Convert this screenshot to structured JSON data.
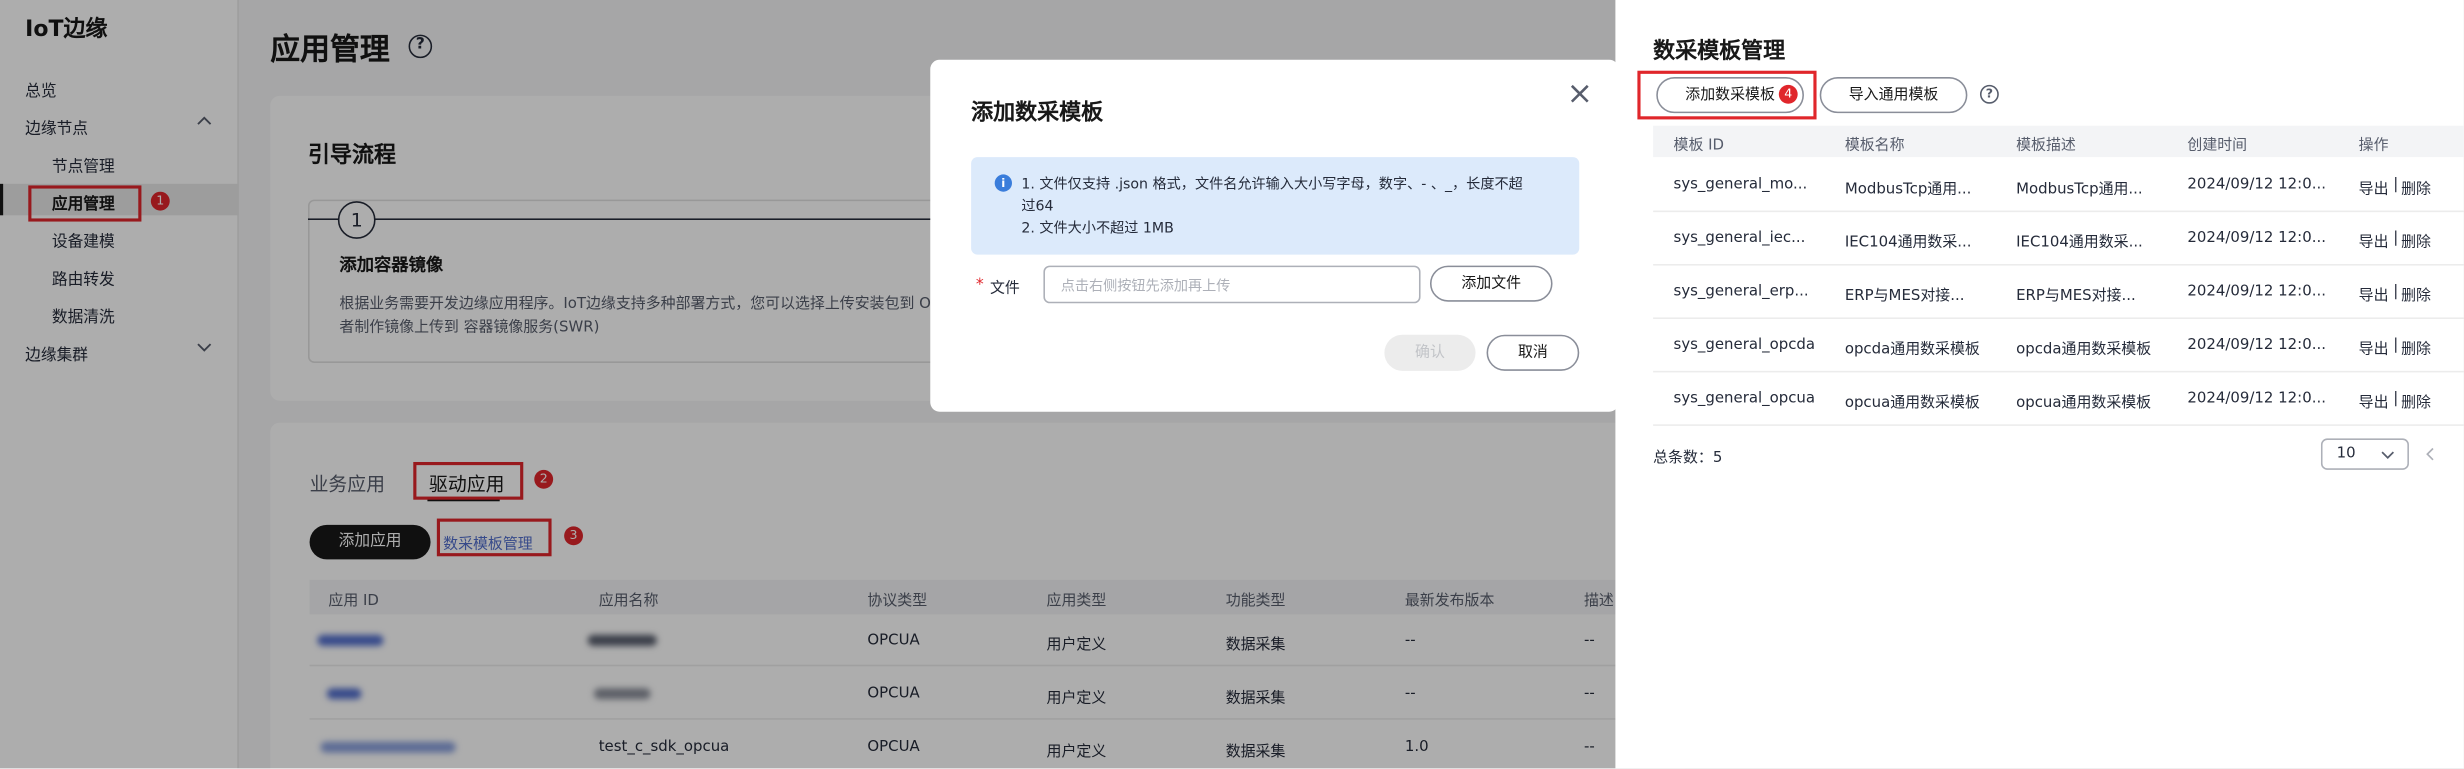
{
  "sidebar": {
    "brand": "IoT边缘",
    "items": [
      {
        "label": "总览"
      },
      {
        "label": "边缘节点"
      },
      {
        "label": "节点管理"
      },
      {
        "label": "应用管理"
      },
      {
        "label": "设备建模"
      },
      {
        "label": "路由转发"
      },
      {
        "label": "数据清洗"
      },
      {
        "label": "边缘集群"
      }
    ]
  },
  "page": {
    "title": "应用管理",
    "help": "?"
  },
  "guide": {
    "title": "引导流程",
    "step_number": "1",
    "step_title": "添加容器镜像",
    "step_desc_1": "根据业务需要开发边缘应用程序。IoT边缘支持多种部署方式，您可以选择上传安装包到 O",
    "step_desc_2": "者制作镜像上传到 容器镜像服务(SWR)"
  },
  "tabs": [
    {
      "label": "业务应用"
    },
    {
      "label": "驱动应用"
    }
  ],
  "actions": {
    "add_app": "添加应用",
    "template_mgmt": "数采模板管理"
  },
  "badges": {
    "b1": "1",
    "b2": "2",
    "b3": "3",
    "b4": "4"
  },
  "app_table": {
    "headers": [
      "应用 ID",
      "应用名称",
      "协议类型",
      "应用类型",
      "功能类型",
      "最新发布版本",
      "描述"
    ],
    "rows": [
      {
        "name": "",
        "protocol": "OPCUA",
        "app_type": "用户定义",
        "func_type": "数据采集",
        "version": "--",
        "desc": "--"
      },
      {
        "name": "",
        "protocol": "OPCUA",
        "app_type": "用户定义",
        "func_type": "数据采集",
        "version": "--",
        "desc": "--"
      },
      {
        "name": "test_c_sdk_opcua",
        "protocol": "OPCUA",
        "app_type": "用户定义",
        "func_type": "数据采集",
        "version": "1.0",
        "desc": "--"
      }
    ]
  },
  "drawer": {
    "title": "数采模板管理",
    "add_btn": "添加数采模板",
    "import_btn": "导入通用模板",
    "help": "?",
    "headers": [
      "模板 ID",
      "模板名称",
      "模板描述",
      "创建时间",
      "操作"
    ],
    "rows": [
      {
        "id": "sys_general_mo...",
        "name": "ModbusTcp通用...",
        "desc": "ModbusTcp通用...",
        "time": "2024/09/12 12:0...",
        "export": "导出",
        "sep": "|",
        "delete": "删除"
      },
      {
        "id": "sys_general_iec...",
        "name": "IEC104通用数采...",
        "desc": "IEC104通用数采...",
        "time": "2024/09/12 12:0...",
        "export": "导出",
        "sep": "|",
        "delete": "删除"
      },
      {
        "id": "sys_general_erp...",
        "name": "ERP与MES对接...",
        "desc": "ERP与MES对接...",
        "time": "2024/09/12 12:0...",
        "export": "导出",
        "sep": "|",
        "delete": "删除"
      },
      {
        "id": "sys_general_opcda",
        "name": "opcda通用数采模板",
        "desc": "opcda通用数采模板",
        "time": "2024/09/12 12:0...",
        "export": "导出",
        "sep": "|",
        "delete": "删除"
      },
      {
        "id": "sys_general_opcua",
        "name": "opcua通用数采模板",
        "desc": "opcua通用数采模板",
        "time": "2024/09/12 12:0...",
        "export": "导出",
        "sep": "|",
        "delete": "删除"
      }
    ],
    "total_label": "总条数：5",
    "page_size": "10"
  },
  "dialog": {
    "title": "添加数采模板",
    "close": "×",
    "info_1": "1. 文件仅支持 .json 格式，文件名允许输入大小写字母，数字、- 、_，长度不超",
    "info_2": "过64",
    "info_3": "2. 文件大小不超过 1MB",
    "required": "*",
    "file_label": "文件",
    "file_placeholder": "点击右侧按钮先添加再上传",
    "add_file_btn": "添加文件",
    "confirm_btn": "确认",
    "cancel_btn": "取消"
  },
  "colors": {
    "accent": "#526ecc",
    "highlight": "#e0262b",
    "info_bg": "#dceafb",
    "info_icon": "#3a7ddb"
  }
}
